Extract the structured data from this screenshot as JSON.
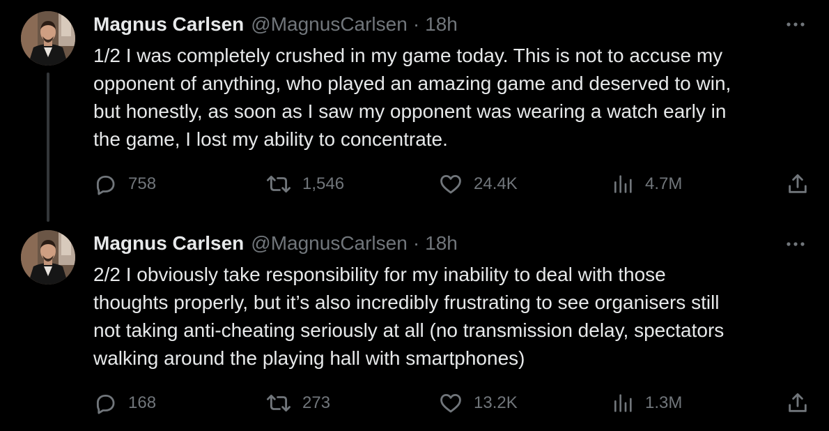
{
  "tweets": [
    {
      "author_name": "Magnus Carlsen",
      "handle": "@MagnusCarlsen",
      "separator": "·",
      "time": "18h",
      "text_lines": [
        "1/2 I was completely crushed in my game today. This is not to accuse my",
        "opponent of anything, who played an amazing game and deserved to win,",
        "but honestly, as soon as I saw my opponent was wearing a watch early in",
        "the game, I lost my ability to concentrate."
      ],
      "replies": "758",
      "retweets": "1,546",
      "likes": "24.4K",
      "views": "4.7M"
    },
    {
      "author_name": "Magnus Carlsen",
      "handle": "@MagnusCarlsen",
      "separator": "·",
      "time": "18h",
      "text_lines": [
        "2/2 I obviously take responsibility for my inability to deal with those",
        "thoughts properly, but it’s also incredibly frustrating to see organisers still",
        "not taking anti-cheating seriously at all (no transmission delay, spectators",
        "walking around the playing hall with smartphones)"
      ],
      "replies": "168",
      "retweets": "273",
      "likes": "13.2K",
      "views": "1.3M"
    }
  ],
  "icons": {
    "reply": "reply-icon",
    "retweet": "retweet-icon",
    "like": "heart-icon",
    "views": "views-icon",
    "share": "share-icon",
    "more": "more-icon"
  },
  "colors": {
    "background": "#000000",
    "primary_text": "#e7e9ea",
    "secondary_text": "#71767b",
    "thread_line": "#333639"
  }
}
